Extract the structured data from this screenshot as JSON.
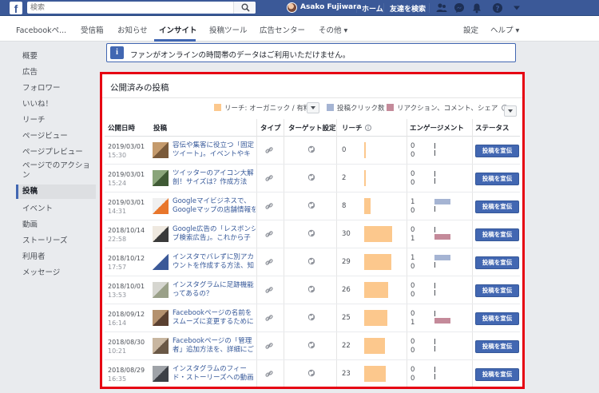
{
  "topbar": {
    "logo": "f",
    "search_placeholder": "検索",
    "user_name": "Asako Fujiwara",
    "home": "ホーム",
    "find_friends": "友達を検索"
  },
  "pagebar": {
    "nav": [
      "Facebookペ...",
      "受信箱",
      "お知らせ",
      "インサイト",
      "投稿ツール",
      "広告センター",
      "その他 ▾"
    ],
    "settings": "設定",
    "help": "ヘルプ ▾"
  },
  "leftnav": [
    "概要",
    "広告",
    "フォロワー",
    "いいね！",
    "リーチ",
    "ページビュー",
    "ページプレビュー",
    "ページでのアクション",
    "投稿",
    "イベント",
    "動画",
    "ストーリーズ",
    "利用者",
    "メッセージ"
  ],
  "leftnav_active": "投稿",
  "banner": {
    "icon": "i",
    "text": "ファンがオンラインの時間帯のデータはご利用いただけません。"
  },
  "posts": {
    "title": "公開済みの投稿",
    "legend1": "リーチ: オーガニック / 有料",
    "legend2": "投稿クリック数",
    "legend3": "リアクション、コメント、シェア",
    "colors": {
      "reach": "#fcc88d",
      "clicks": "#a5b4d3",
      "reactions": "#c48a9a"
    },
    "headers": {
      "date": "公開日時",
      "post": "投稿",
      "type": "タイプ",
      "targeting": "ターゲット設定",
      "reach": "リーチ",
      "engagement": "エンゲージメント",
      "status": "ステータス"
    },
    "rows": [
      {
        "date": "2019/03/01",
        "time": "15:30",
        "t1": "容伝や集客に役立つ「固定",
        "t2": "ツイート」。イベントやキ",
        "reach": "0",
        "e1": "0",
        "e2": "0",
        "reach_frac": 0.03,
        "click_frac": 0,
        "react_frac": 0,
        "button": "投稿を宣伝"
      },
      {
        "date": "2019/03/01",
        "time": "15:24",
        "t1": "ツイッターのアイコン大解",
        "t2": "剖！サイズは？作成方法",
        "reach": "2",
        "e1": "0",
        "e2": "0",
        "reach_frac": 0.05,
        "click_frac": 0,
        "react_frac": 0,
        "button": "投稿を宣伝"
      },
      {
        "date": "2019/03/01",
        "time": "14:31",
        "t1": "Googleマイビジネスで、",
        "t2": "Googleマップの店舗情報を",
        "reach": "8",
        "e1": "1",
        "e2": "0",
        "reach_frac": 0.22,
        "click_frac": 0.5,
        "react_frac": 0,
        "button": "投稿を宣伝"
      },
      {
        "date": "2018/10/14",
        "time": "22:58",
        "t1": "Google広告の「レスポンシ",
        "t2": "ブ検索広告」。これから子",
        "reach": "30",
        "e1": "0",
        "e2": "1",
        "reach_frac": 0.97,
        "click_frac": 0,
        "react_frac": 0.5,
        "button": "投稿を宣伝"
      },
      {
        "date": "2018/10/12",
        "time": "17:57",
        "t1": "インスタでバレずに別アカ",
        "t2": "ウントを作成する方法、知",
        "reach": "29",
        "e1": "1",
        "e2": "0",
        "reach_frac": 0.94,
        "click_frac": 0.5,
        "react_frac": 0,
        "button": "投稿を宣伝"
      },
      {
        "date": "2018/10/01",
        "time": "13:53",
        "t1": "インスタグラムに足跡機能",
        "t2": "ってあるの？",
        "reach": "26",
        "e1": "0",
        "e2": "0",
        "reach_frac": 0.84,
        "click_frac": 0,
        "react_frac": 0,
        "button": "投稿を宣伝"
      },
      {
        "date": "2018/09/12",
        "time": "16:14",
        "t1": "Facebookページの名前を",
        "t2": "スムーズに変更するために",
        "reach": "25",
        "e1": "0",
        "e2": "1",
        "reach_frac": 0.81,
        "click_frac": 0,
        "react_frac": 0.5,
        "button": "投稿を宣伝"
      },
      {
        "date": "2018/08/30",
        "time": "10:21",
        "t1": "Facebookページの「管理",
        "t2": "者」追加方法を、詳細にご",
        "reach": "22",
        "e1": "0",
        "e2": "0",
        "reach_frac": 0.71,
        "click_frac": 0,
        "react_frac": 0,
        "button": "投稿を宣伝"
      },
      {
        "date": "2018/08/29",
        "time": "16:35",
        "t1": "インスタグラムのフィー",
        "t2": "ド・ストーリーズへの動画",
        "reach": "23",
        "e1": "0",
        "e2": "0",
        "reach_frac": 0.74,
        "click_frac": 0,
        "react_frac": 0,
        "button": "投稿を宣伝"
      }
    ]
  }
}
